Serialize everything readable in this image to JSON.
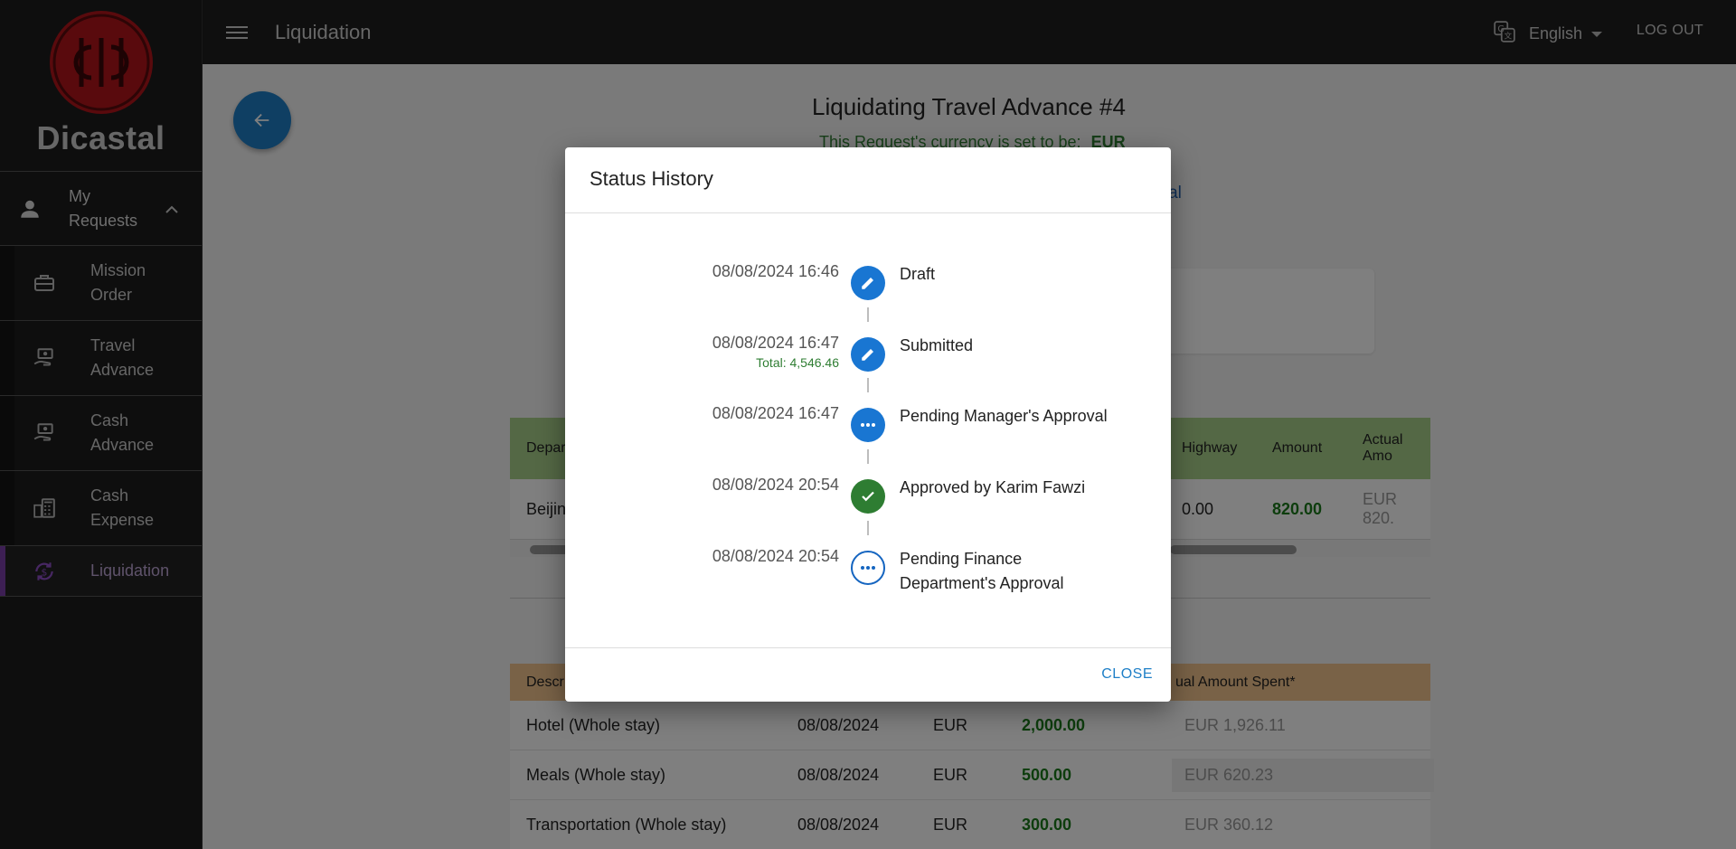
{
  "app": {
    "brand": "Dicastal",
    "page_title": "Liquidation"
  },
  "sidebar": {
    "parent": {
      "label": "My Requests",
      "icon": "person-icon"
    },
    "items": [
      {
        "label": "Mission Order",
        "icon": "briefcase-icon"
      },
      {
        "label": "Travel Advance",
        "icon": "cash-hand-icon"
      },
      {
        "label": "Cash Advance",
        "icon": "cash-hand-icon"
      },
      {
        "label": "Cash Expense",
        "icon": "calculator-cash-icon"
      },
      {
        "label": "Liquidation",
        "icon": "refresh-dollar-icon",
        "active": true
      }
    ]
  },
  "topbar": {
    "language": "English",
    "logout": "LOG OUT"
  },
  "page": {
    "heading": "Liquidating Travel Advance #4",
    "currency_prefix": "This Request's currency is set to be:",
    "currency_value": "EUR",
    "status_link_fragment": "oval",
    "table1": {
      "headers": [
        "Depar",
        "Highway",
        "Amount",
        "Actual Amo"
      ],
      "row": {
        "city": "Beijin",
        "highway": "0.00",
        "amount": "820.00",
        "actual": "EUR 820."
      }
    },
    "table2": {
      "headers": [
        "Descr",
        "ual Amount Spent*"
      ],
      "rows": [
        {
          "desc": "Hotel (Whole stay)",
          "date": "08/08/2024",
          "cur": "EUR",
          "amount": "2,000.00",
          "actual": "EUR 1,926.11"
        },
        {
          "desc": "Meals (Whole stay)",
          "date": "08/08/2024",
          "cur": "EUR",
          "amount": "500.00",
          "actual": "EUR 620.23"
        },
        {
          "desc": "Transportation (Whole stay)",
          "date": "08/08/2024",
          "cur": "EUR",
          "amount": "300.00",
          "actual": "EUR 360.12"
        }
      ]
    }
  },
  "dialog": {
    "title": "Status History",
    "close_label": "CLOSE",
    "timeline": [
      {
        "time": "08/08/2024 16:46",
        "label": "Draft",
        "icon": "pencil-icon",
        "style": "blue"
      },
      {
        "time": "08/08/2024 16:47",
        "label": "Submitted",
        "total": "Total: 4,546.46",
        "icon": "pencil-icon",
        "style": "blue"
      },
      {
        "time": "08/08/2024 16:47",
        "label": "Pending Manager's Approval",
        "icon": "dots-icon",
        "style": "blue"
      },
      {
        "time": "08/08/2024 20:54",
        "label": "Approved by Karim Fawzi",
        "icon": "check-icon",
        "style": "green"
      },
      {
        "time": "08/08/2024 20:54",
        "label": "Pending Finance Department's Approval",
        "icon": "dots-icon",
        "style": "outline"
      }
    ]
  },
  "colors": {
    "accent": "#1976d2",
    "success": "#2e7d32",
    "active_nav": "#7b3fa9",
    "brand_red": "#b3151b"
  }
}
